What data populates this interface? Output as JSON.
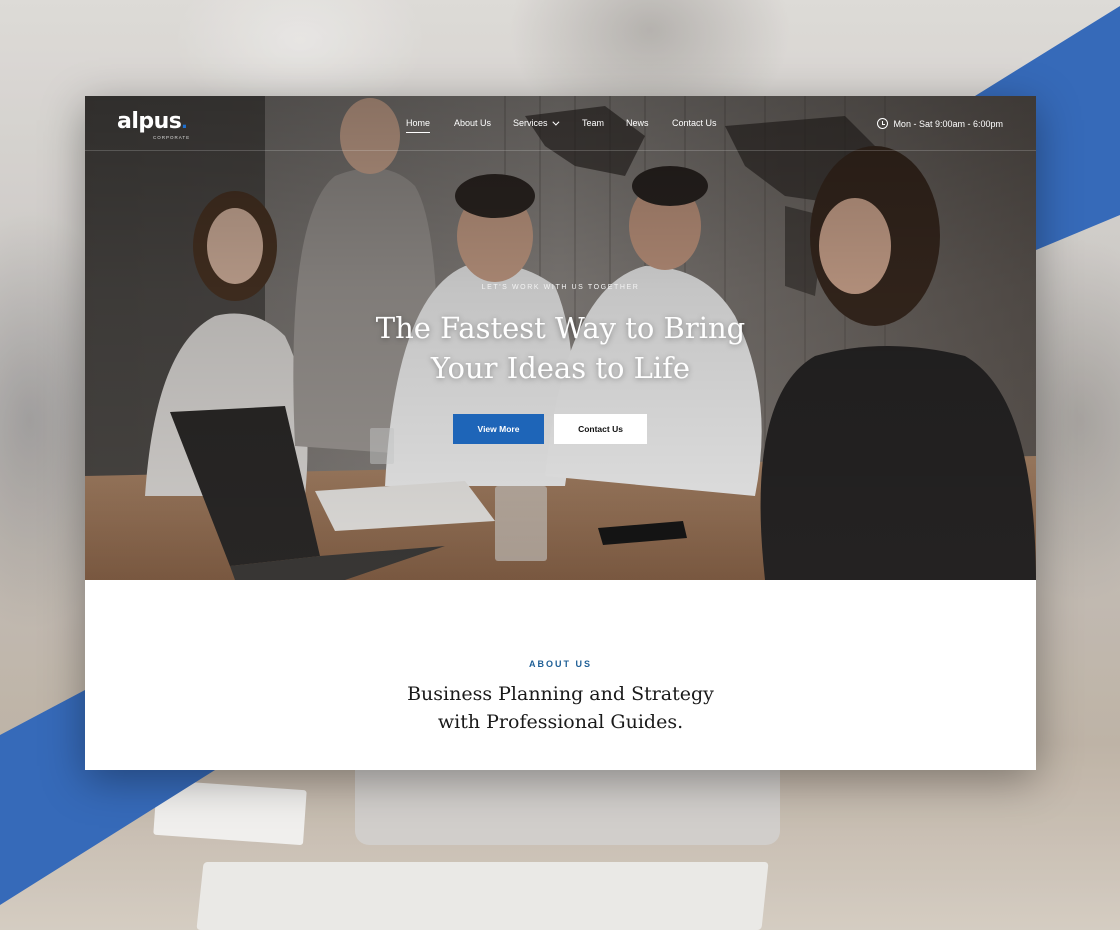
{
  "brand": {
    "name": "alpus",
    "tagline": "CORPORATE",
    "accent_color": "#1e65b8"
  },
  "nav": {
    "items": [
      {
        "label": "Home",
        "active": true
      },
      {
        "label": "About Us",
        "active": false
      },
      {
        "label": "Services",
        "active": false,
        "has_dropdown": true
      },
      {
        "label": "Team",
        "active": false
      },
      {
        "label": "News",
        "active": false
      },
      {
        "label": "Contact Us",
        "active": false
      }
    ],
    "hours": {
      "icon": "clock-icon",
      "text": "Mon - Sat 9:00am - 6:00pm"
    }
  },
  "hero": {
    "eyebrow": "LET'S WORK WITH US TOGETHER",
    "headline_line1": "The Fastest Way to Bring",
    "headline_line2": "Your Ideas to Life",
    "primary_button": "View More",
    "secondary_button": "Contact Us"
  },
  "about": {
    "kicker": "ABOUT US",
    "title_line1": "Business Planning and Strategy",
    "title_line2": "with Professional Guides."
  }
}
